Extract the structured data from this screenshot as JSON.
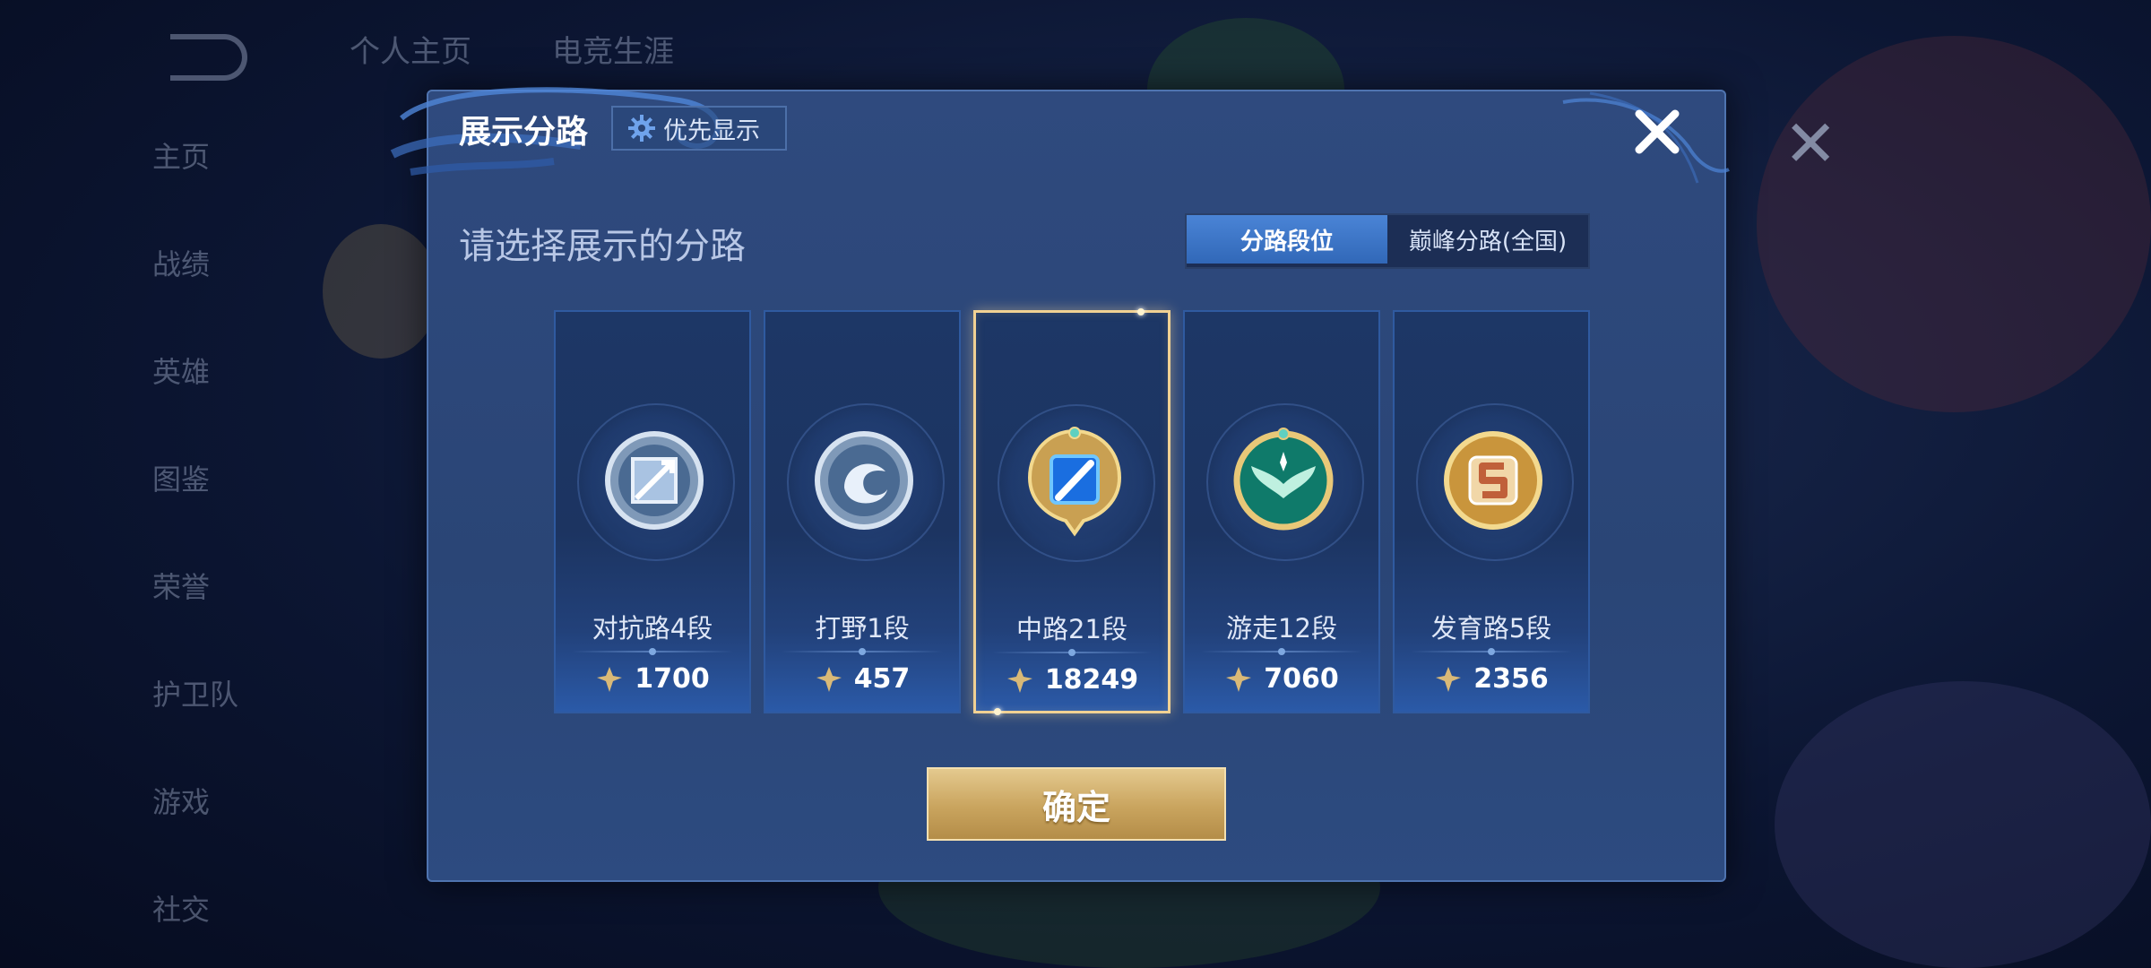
{
  "background": {
    "tabs": [
      "个人主页",
      "电竞生涯"
    ],
    "sidebar": [
      "主页",
      "战绩",
      "英雄",
      "图鉴",
      "荣誉",
      "护卫队",
      "游戏",
      "社交"
    ]
  },
  "modal": {
    "title": "展示分路",
    "priority_label": "优先显示",
    "subtitle": "请选择展示的分路",
    "segment": {
      "options": [
        "分路段位",
        "巅峰分路(全国)"
      ],
      "selected": "分路段位"
    },
    "cards": [
      {
        "rank": "对抗路4段",
        "points": "1700",
        "emblem": "silver-sword-emblem-icon",
        "selected": false
      },
      {
        "rank": "打野1段",
        "points": "457",
        "emblem": "silver-dragon-emblem-icon",
        "selected": false
      },
      {
        "rank": "中路21段",
        "points": "18249",
        "emblem": "gold-blue-crest-emblem-icon",
        "selected": true
      },
      {
        "rank": "游走12段",
        "points": "7060",
        "emblem": "green-wings-emblem-icon",
        "selected": false
      },
      {
        "rank": "发育路5段",
        "points": "2356",
        "emblem": "gold-s-emblem-icon",
        "selected": false
      }
    ],
    "confirm_label": "确定"
  },
  "colors": {
    "modal_bg": "#2f4a7e",
    "accent_blue": "#3f7ad0",
    "gold": "#d4b06a",
    "selected_border": "#f1d193"
  }
}
